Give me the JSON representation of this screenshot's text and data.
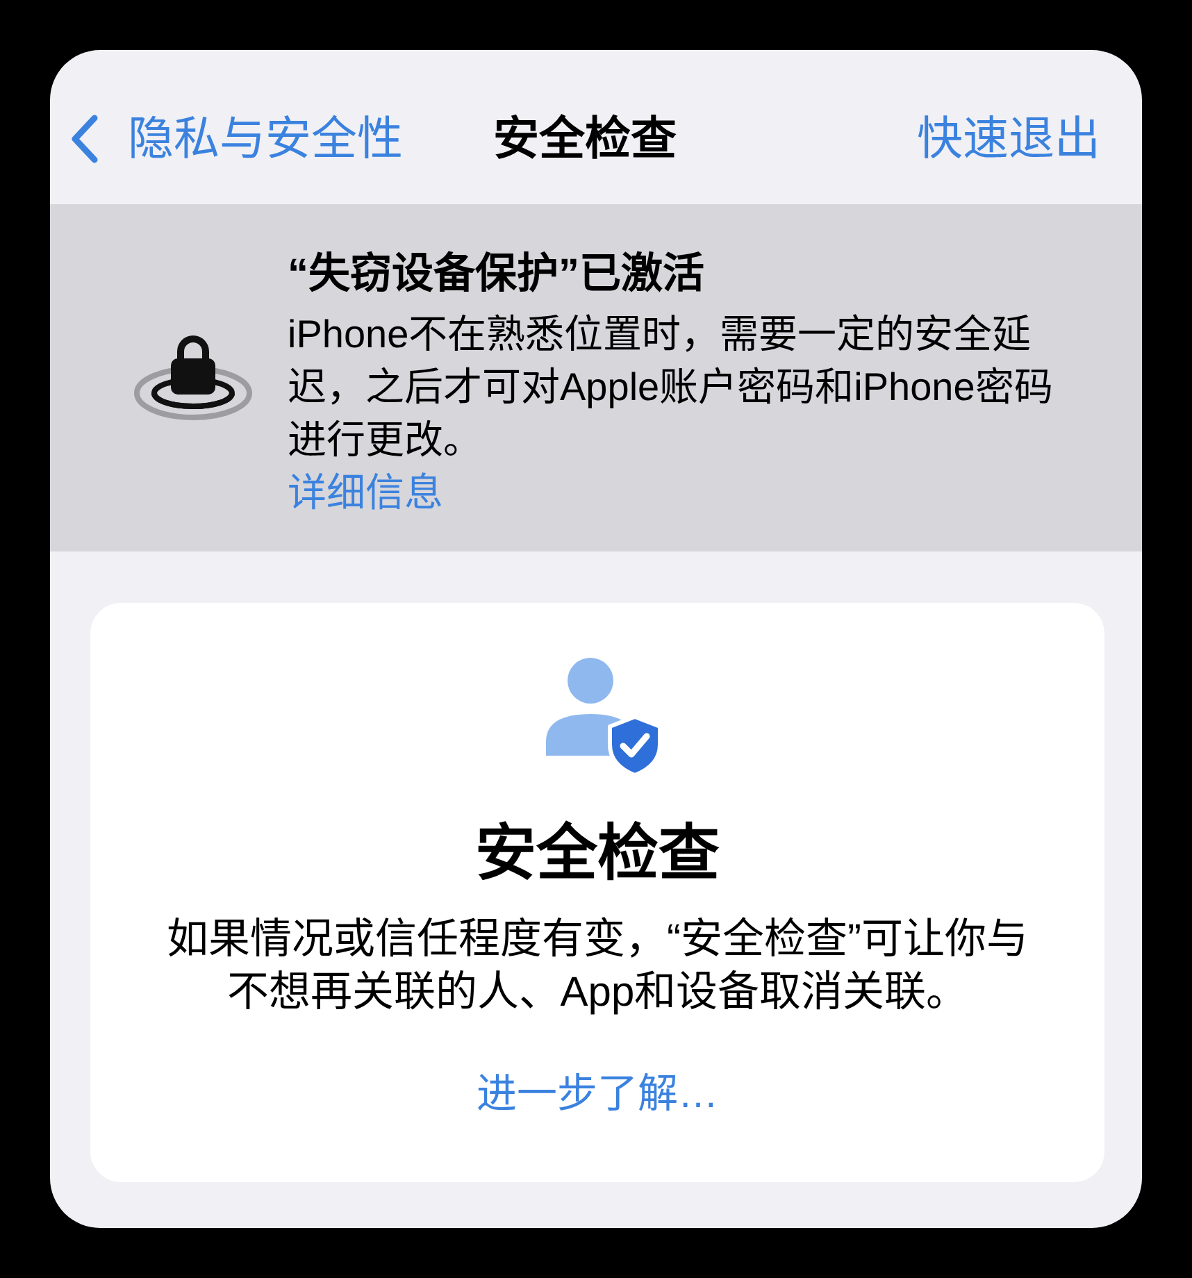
{
  "nav": {
    "back_label": "隐私与安全性",
    "title": "安全检查",
    "action": "快速退出"
  },
  "banner": {
    "title": "“失窃设备保护”已激活",
    "body": "iPhone不在熟悉位置时，需要一定的安全延迟，之后才可对Apple账户密码和iPhone密码进行更改。",
    "link": "详细信息"
  },
  "card": {
    "title": "安全检查",
    "body": "如果情况或信任程度有变，“安全检查”可让你与不想再关联的人、App和设备取消关联。",
    "link": "进一步了解…"
  }
}
